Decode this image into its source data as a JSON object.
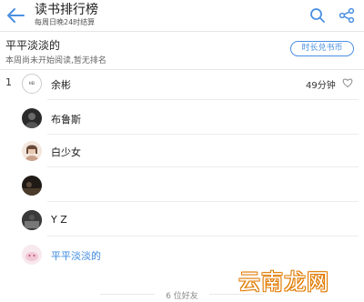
{
  "header": {
    "title": "读书排行榜",
    "subtitle": "每周日晚24时结算",
    "back_icon": "back-arrow-icon",
    "search_icon": "search-icon",
    "share_icon": "share-icon",
    "accent_color": "#4a90e2"
  },
  "me": {
    "name": "平平淡淡的",
    "status": "本周尚未开始阅读,暂无排名",
    "shop_button": "时长兑书币"
  },
  "ranking": [
    {
      "rank": "1",
      "name": "余彬",
      "duration": "49分钟",
      "avatar_text": "HEI"
    },
    {
      "rank": "",
      "name": "布鲁斯",
      "duration": ""
    },
    {
      "rank": "",
      "name": "白少女",
      "duration": ""
    },
    {
      "rank": "",
      "name": "",
      "duration": ""
    },
    {
      "rank": "",
      "name": "Y Z",
      "duration": ""
    },
    {
      "rank": "",
      "name": "平平淡淡的",
      "duration": ""
    }
  ],
  "footer": {
    "friends_count": "6 位好友"
  },
  "watermark": "云南龙网"
}
